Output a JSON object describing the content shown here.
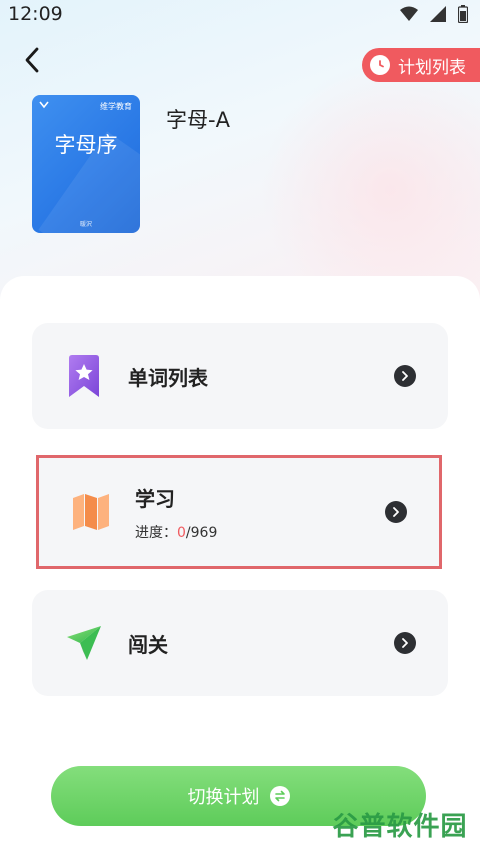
{
  "status_bar": {
    "time": "12:09"
  },
  "header": {
    "plan_list_label": "计划列表"
  },
  "book": {
    "cover_title": "字母序",
    "cover_brand": "维学教育",
    "cover_sub": "暖沢",
    "title": "字母-A"
  },
  "cards": [
    {
      "label": "单词列表",
      "icon": "bookmark-star-icon"
    },
    {
      "label": "学习",
      "icon": "map-icon",
      "progress_prefix": "进度：",
      "progress_current": "0",
      "progress_total": "/969"
    },
    {
      "label": "闯关",
      "icon": "paper-plane-icon"
    }
  ],
  "footer": {
    "switch_label": "切换计划"
  },
  "watermark": "谷普软件园",
  "colors": {
    "accent_red": "#f05a5f",
    "accent_green": "#5ecc5a",
    "highlight_border": "#e0676b"
  }
}
